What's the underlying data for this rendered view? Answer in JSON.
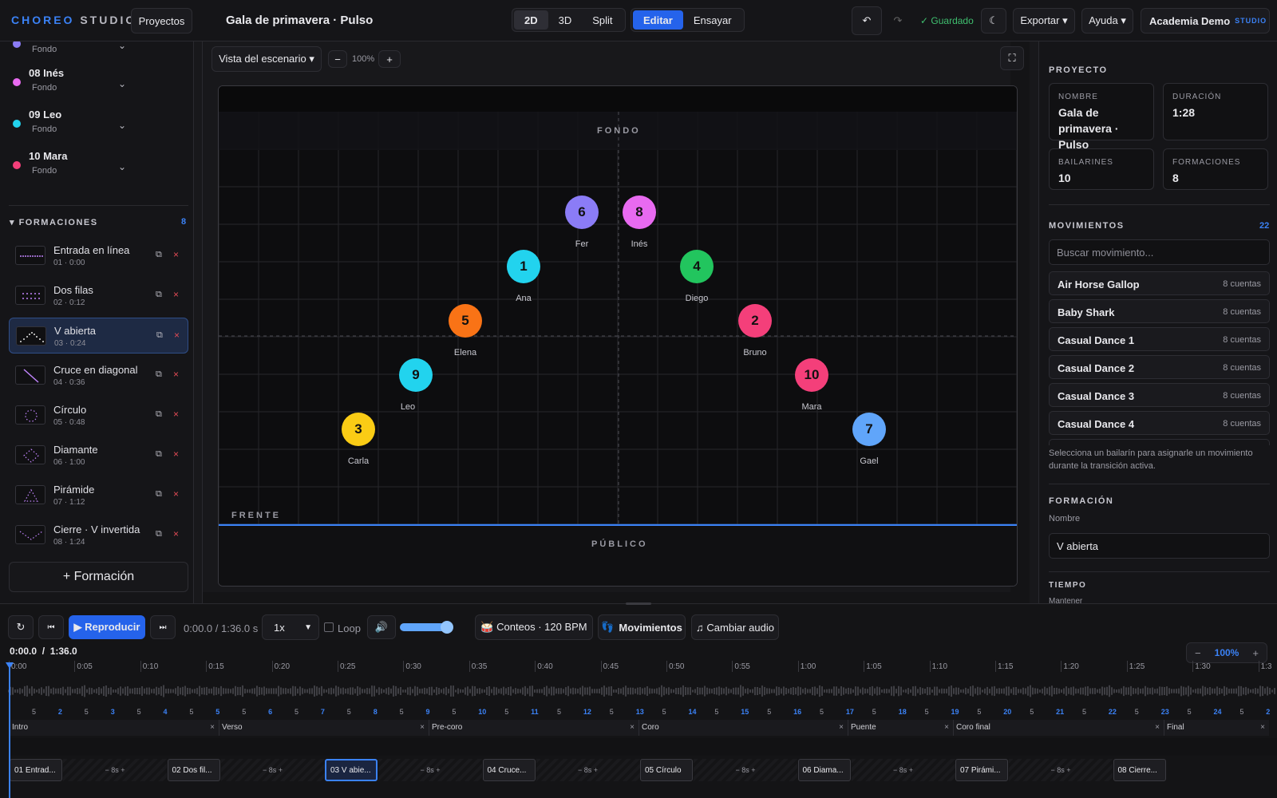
{
  "topbar": {
    "logo_a": "CHOREO",
    "logo_b": "STUDIO",
    "projects_btn": "Proyectos",
    "title": "Gala de primavera · Pulso",
    "view_modes": [
      "2D",
      "3D",
      "Split"
    ],
    "edit_modes": [
      "Editar",
      "Ensayar"
    ],
    "saved": "✓ Guardado",
    "export": "Exportar ▾",
    "help": "Ayuda ▾",
    "account": "Academia Demo",
    "badge": "STUDIO"
  },
  "sidebar": {
    "dancers": [
      {
        "name": "",
        "pos": "Fondo",
        "color": "#8b7cf6"
      },
      {
        "name": "08 Inés",
        "pos": "Fondo",
        "color": "#e86af0"
      },
      {
        "name": "09 Leo",
        "pos": "Fondo",
        "color": "#22d3ee"
      },
      {
        "name": "10 Mara",
        "pos": "Fondo",
        "color": "#f43f7a"
      }
    ],
    "formations_header": "FORMACIONES",
    "formations_count": "8",
    "formations": [
      {
        "name": "Entrada en línea",
        "time": "01 · 0:00"
      },
      {
        "name": "Dos filas",
        "time": "02 · 0:12"
      },
      {
        "name": "V abierta",
        "time": "03 · 0:24"
      },
      {
        "name": "Cruce en diagonal",
        "time": "04 · 0:36"
      },
      {
        "name": "Círculo",
        "time": "05 · 0:48"
      },
      {
        "name": "Diamante",
        "time": "06 · 1:00"
      },
      {
        "name": "Pirámide",
        "time": "07 · 1:12"
      },
      {
        "name": "Cierre · V invertida",
        "time": "08 · 1:24"
      }
    ],
    "add_formation": "+ Formación"
  },
  "stage": {
    "view_select": "Vista del escenario ▾",
    "zoom": "100%",
    "zoom_minus": "−",
    "zoom_plus": "+",
    "label_back": "FONDO",
    "label_front": "FRENTE",
    "label_audience": "PÚBLICO",
    "dancers": [
      {
        "n": "1",
        "name": "Ana",
        "color": "#22d3ee"
      },
      {
        "n": "2",
        "name": "Bruno",
        "color": "#f43f7a"
      },
      {
        "n": "3",
        "name": "Carla",
        "color": "#facc15"
      },
      {
        "n": "4",
        "name": "Diego",
        "color": "#22c55e"
      },
      {
        "n": "5",
        "name": "Elena",
        "color": "#f97316"
      },
      {
        "n": "6",
        "name": "Fer",
        "color": "#8b7cf6"
      },
      {
        "n": "7",
        "name": "Gael",
        "color": "#60a5fa"
      },
      {
        "n": "8",
        "name": "Inés",
        "color": "#e86af0"
      },
      {
        "n": "9",
        "name": "Leo",
        "color": "#22d3ee"
      },
      {
        "n": "10",
        "name": "Mara",
        "color": "#f43f7a"
      }
    ]
  },
  "right": {
    "project_header": "PROYECTO",
    "cards": [
      {
        "k": "NOMBRE",
        "v": "Gala de primavera · Pulso"
      },
      {
        "k": "DURACIÓN",
        "v": "1:28"
      },
      {
        "k": "BAILARINES",
        "v": "10"
      },
      {
        "k": "FORMACIONES",
        "v": "8"
      }
    ],
    "moves_header": "MOVIMIENTOS",
    "moves_count": "22",
    "search_placeholder": "Buscar movimiento...",
    "moves": [
      {
        "name": "Air Horse Gallop",
        "count": "8 cuentas"
      },
      {
        "name": "Baby Shark",
        "count": "8 cuentas"
      },
      {
        "name": "Casual Dance 1",
        "count": "8 cuentas"
      },
      {
        "name": "Casual Dance 2",
        "count": "8 cuentas"
      },
      {
        "name": "Casual Dance 3",
        "count": "8 cuentas"
      },
      {
        "name": "Casual Dance 4",
        "count": "8 cuentas"
      }
    ],
    "hint": "Selecciona un bailarín para asignarle un movimiento durante la transición activa.",
    "formation_header": "FORMACIÓN",
    "name_label": "Nombre",
    "formation_name": "V abierta",
    "time_header": "TIEMPO",
    "cut_label": "Mantener"
  },
  "transport": {
    "play": "▶ Reproducir",
    "time": "0:00.0 / 1:36.0 s",
    "speed": "1x",
    "loop": "Loop",
    "volume": 0.9,
    "counts": "🥁 Conteos · 120 BPM",
    "moves": "Movimientos",
    "change_audio": "♫ Cambiar audio",
    "timecode": "0:00.0  /  1:36.0",
    "tl_zoom": "100%",
    "tl_minus": "−",
    "tl_plus": "+"
  },
  "timeline": {
    "ticks": [
      "0:00",
      "0:05",
      "0:10",
      "0:15",
      "0:20",
      "0:25",
      "0:30",
      "0:35",
      "0:40",
      "0:45",
      "0:50",
      "0:55",
      "1:00",
      "1:05",
      "1:10",
      "1:15",
      "1:20",
      "1:25",
      "1:30",
      "1:3"
    ],
    "counts": [
      "5",
      "2",
      "5",
      "3",
      "5",
      "4",
      "5",
      "5",
      "5",
      "6",
      "5",
      "7",
      "5",
      "8",
      "5",
      "9",
      "5",
      "10",
      "5",
      "11",
      "5",
      "12",
      "5",
      "13",
      "5",
      "14",
      "5",
      "15",
      "5",
      "16",
      "5",
      "17",
      "5",
      "18",
      "5",
      "19",
      "5",
      "20",
      "5",
      "21",
      "5",
      "22",
      "5",
      "23",
      "5",
      "24",
      "5",
      "2"
    ],
    "sections": [
      "Intro",
      "Verso",
      "Pre-coro",
      "Coro",
      "Puente",
      "Coro final",
      "Final"
    ],
    "blocks": [
      "01 Entrad...",
      "02 Dos fil...",
      "03 V abie...",
      "04 Cruce...",
      "05 Círculo",
      "06 Diama...",
      "07 Pirámi...",
      "08 Cierre..."
    ],
    "transition": "−  8s  +"
  }
}
